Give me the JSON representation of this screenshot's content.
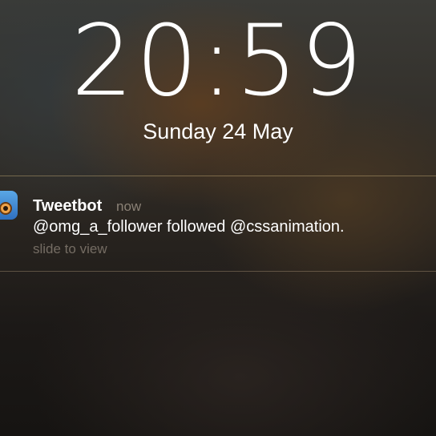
{
  "lock_screen": {
    "time": "20:59",
    "date": "Sunday 24 May"
  },
  "notification": {
    "app_name": "Tweetbot",
    "app_icon": "tweetbot-icon",
    "timestamp": "now",
    "message": "@omg_a_follower followed @cssanimation.",
    "action_hint": "slide to view"
  },
  "colors": {
    "text_primary": "#ffffff",
    "text_secondary": "#8a8176",
    "divider": "#c8af78"
  }
}
